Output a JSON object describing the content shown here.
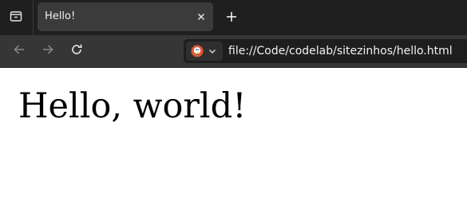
{
  "tabs": [
    {
      "title": "Hello!",
      "active": true
    }
  ],
  "toolbar": {
    "url": "file://Code/codelab/sitezinhos/hello.html"
  },
  "icons": {
    "tab_overview": "tab-overview-icon",
    "tab_close": "close-icon",
    "new_tab": "plus-icon",
    "back": "arrow-left-icon",
    "forward": "arrow-right-icon",
    "reload": "reload-icon",
    "site_identity": "duckduckgo-icon",
    "site_menu": "chevron-down-icon"
  },
  "page": {
    "heading": "Hello, world!"
  },
  "colors": {
    "tabbar_bg": "#1f1f1f",
    "active_tab_bg": "#3b3b3b",
    "toolbar_bg": "#363636",
    "urlbar_bg": "#1e1e1e",
    "page_bg": "#ffffff"
  }
}
